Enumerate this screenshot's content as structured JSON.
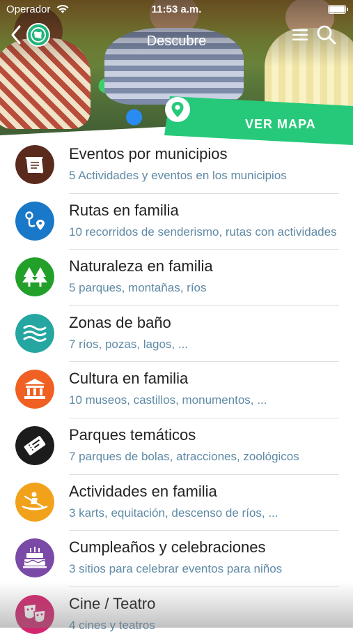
{
  "status_bar": {
    "carrier": "Operador",
    "time": "11:53 a.m."
  },
  "nav": {
    "title": "Descubre",
    "back_icon": "chevron-left-icon",
    "logo_icon": "globe-logo-icon",
    "menu_icon": "hamburger-menu-icon",
    "search_icon": "search-icon"
  },
  "map_banner": {
    "label": "VER MAPA",
    "icon": "location-pin-icon",
    "color": "#26c97a"
  },
  "categories": [
    {
      "title": "Eventos por municipios",
      "subtitle": "5 Actividades y eventos en los municipios",
      "icon": "scroll-icon",
      "color": "#5a2a1c"
    },
    {
      "title": "Rutas en familia",
      "subtitle": "10 recorridos de senderismo, rutas con actividades",
      "icon": "route-icon",
      "color": "#1a78c8"
    },
    {
      "title": "Naturaleza en familia",
      "subtitle": "5 parques, montañas, ríos",
      "icon": "trees-icon",
      "color": "#22a02a"
    },
    {
      "title": "Zonas de baño",
      "subtitle": "7 ríos, pozas, lagos, ...",
      "icon": "waves-icon",
      "color": "#25a6a0"
    },
    {
      "title": "Cultura en familia",
      "subtitle": "10 museos, castillos, monumentos, ...",
      "icon": "museum-icon",
      "color": "#f06022"
    },
    {
      "title": "Parques temáticos",
      "subtitle": "7 parques de bolas, atracciones, zoológicos",
      "icon": "ticket-icon",
      "color": "#1c1c1c"
    },
    {
      "title": "Actividades en familia",
      "subtitle": "3 karts, equitación, descenso de ríos, ...",
      "icon": "kayak-icon",
      "color": "#f2a21a"
    },
    {
      "title": "Cumpleaños y celebraciones",
      "subtitle": "3 sitios para celebrar eventos para niños",
      "icon": "cake-icon",
      "color": "#7a4aa6"
    },
    {
      "title": "Cine / Teatro",
      "subtitle": "4 cines y teatros",
      "icon": "theater-masks-icon",
      "color": "#d2266e"
    }
  ]
}
